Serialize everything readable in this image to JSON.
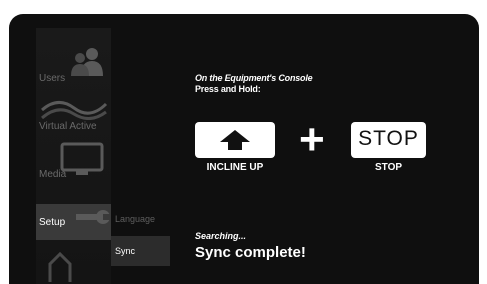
{
  "sidebar": {
    "items": [
      {
        "label": "Users",
        "icon": "users-icon"
      },
      {
        "label": "Virtual Active",
        "icon": "waves-icon"
      },
      {
        "label": "Media",
        "icon": "monitor-icon"
      },
      {
        "label": "Setup",
        "icon": "wrench-icon"
      },
      {
        "label": "",
        "icon": "home-icon"
      }
    ]
  },
  "subpanel": {
    "items": [
      {
        "label": "Language"
      },
      {
        "label": "Sync"
      }
    ]
  },
  "main": {
    "instruction_line1": "On the Equipment's Console",
    "instruction_line2": "Press and Hold:",
    "incline_label": "INCLINE UP",
    "plus": "+",
    "stop_key_text": "STOP",
    "stop_label": "STOP",
    "searching": "Searching...",
    "status": "Sync complete!"
  }
}
